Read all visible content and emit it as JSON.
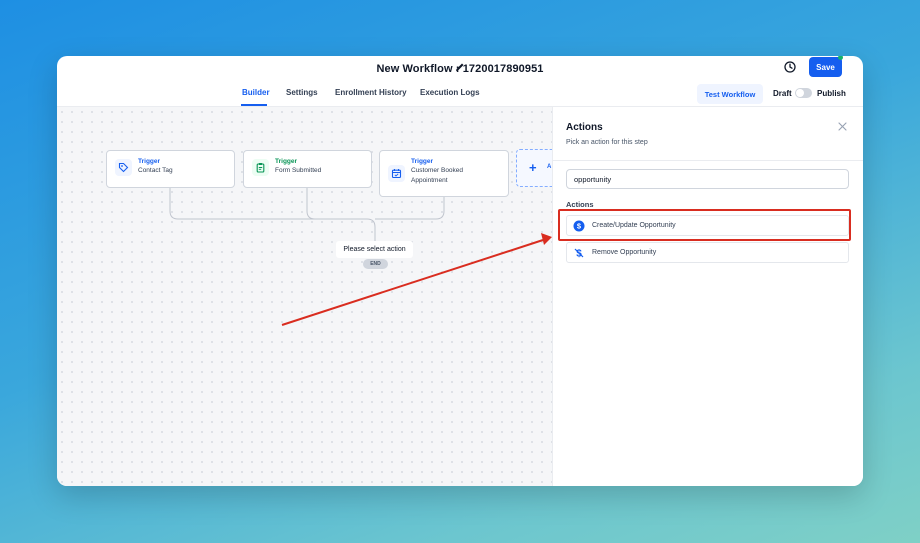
{
  "titlebar": {
    "workflow_title": "New Workflow : 1720017890951",
    "save_label": "Save"
  },
  "tabs": [
    {
      "label": "Builder",
      "active": true
    },
    {
      "label": "Settings",
      "active": false
    },
    {
      "label": "Enrollment History",
      "active": false
    },
    {
      "label": "Execution Logs",
      "active": false
    }
  ],
  "toolbar": {
    "test_workflow_label": "Test Workflow",
    "draft_label": "Draft",
    "publish_label": "Publish",
    "published": false
  },
  "canvas": {
    "triggers": [
      {
        "kind": "Trigger",
        "name_lines": [
          "Contact Tag"
        ],
        "icon": "tag-icon",
        "color": "#155eef"
      },
      {
        "kind": "Trigger",
        "name_lines": [
          "Form Submitted"
        ],
        "icon": "clipboard-icon",
        "color": "#079455"
      },
      {
        "kind": "Trigger",
        "name_lines": [
          "Customer Booked",
          "Appointment"
        ],
        "icon": "calendar-icon",
        "color": "#155eef"
      }
    ],
    "add_trigger_partial": "A",
    "select_action_label": "Please select action",
    "end_label": "END"
  },
  "panel": {
    "title": "Actions",
    "subtitle": "Pick an action for this step",
    "search_value": "opportunity",
    "section_label": "Actions",
    "items": [
      {
        "label": "Create/Update Opportunity",
        "icon": "dollar-circle-icon"
      },
      {
        "label": "Remove Opportunity",
        "icon": "dollar-slash-icon"
      }
    ]
  },
  "colors": {
    "accent": "#155eef",
    "annotation": "#d92d20"
  }
}
